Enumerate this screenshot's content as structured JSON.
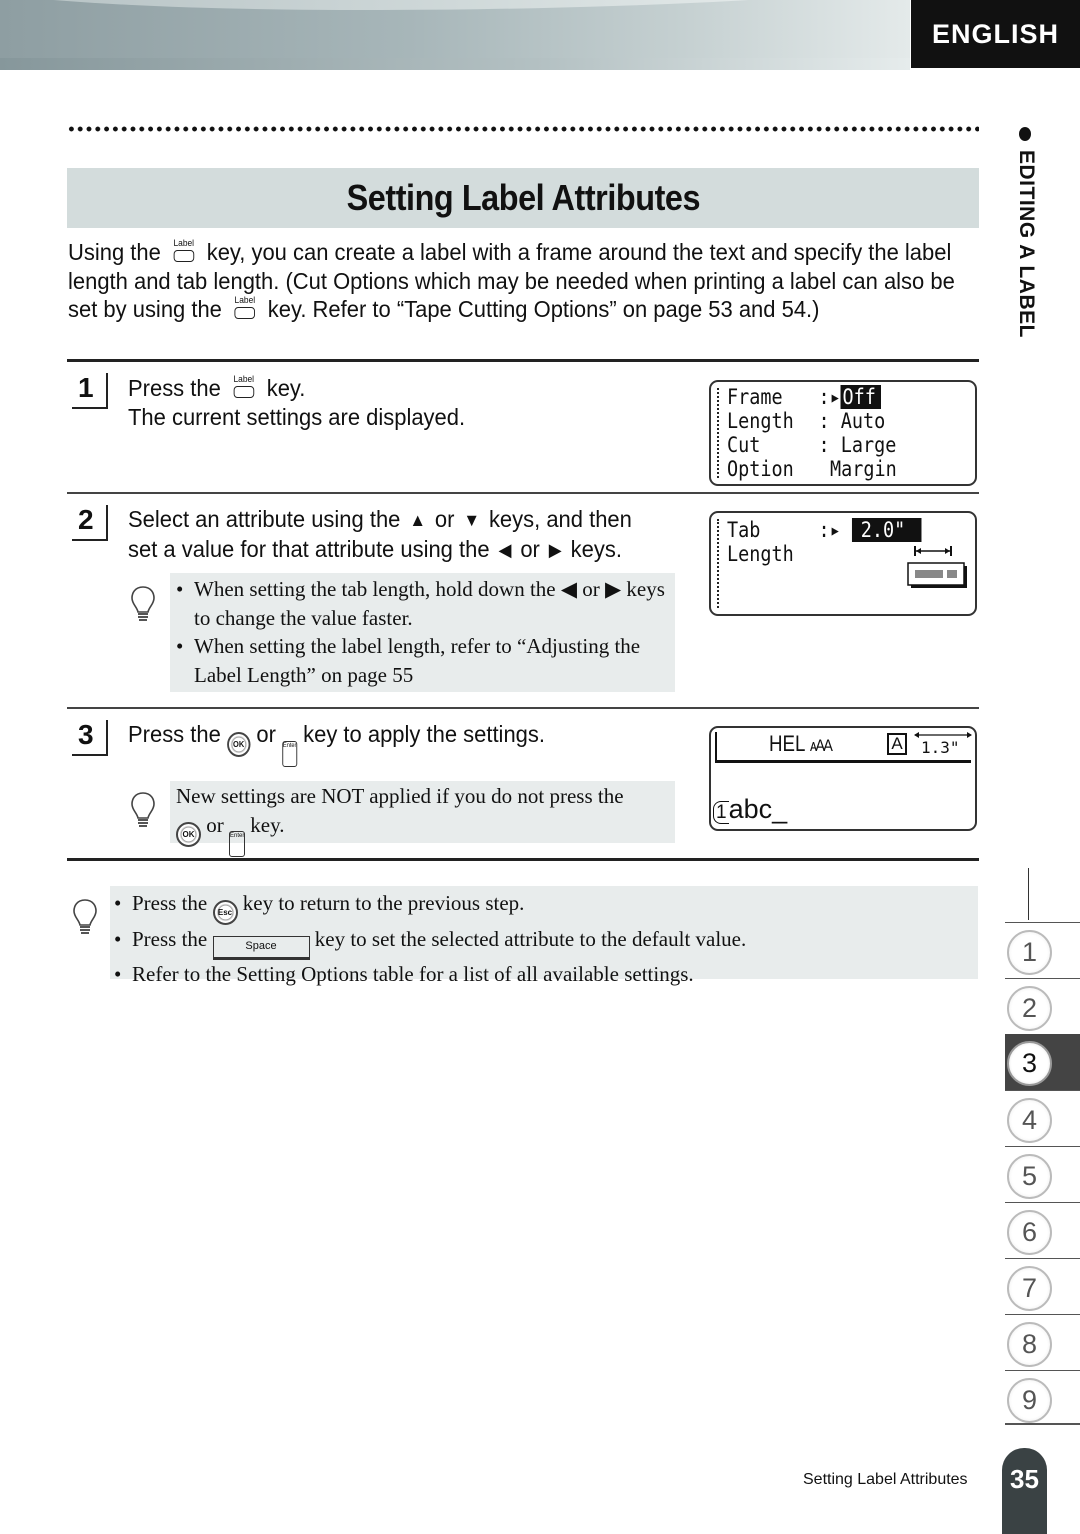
{
  "header": {
    "language_tab": "ENGLISH"
  },
  "side": {
    "section_title": "EDITING A LABEL"
  },
  "page": {
    "title": "Setting Label Attributes",
    "intro": {
      "p1": "Using the",
      "p2": "key, you can create a label with a frame around the text and specify the label length and tab length. (Cut Options which may be needed when printing a label can also be set by using the",
      "p3": "key. Refer to “Tape Cutting Options”  on page 53 and 54.)"
    },
    "key_labels": {
      "label": "Label",
      "ok": "OK",
      "enter": "Enter",
      "esc": "Esc",
      "space": "Space"
    },
    "steps": [
      {
        "number": "1",
        "line1_pre": "Press the",
        "line1_post": "key.",
        "line2": "The current settings are displayed.",
        "lcd": [
          {
            "name": "Frame",
            "sep": ":▸",
            "value": "Off",
            "selected": true
          },
          {
            "name": "Length",
            "sep": ":",
            "value": "Auto"
          },
          {
            "name": "Cut",
            "sep": ":",
            "value": "Large"
          },
          {
            "name": "Option",
            "sep": "",
            "value": "Margin"
          }
        ]
      },
      {
        "number": "2",
        "line1_pre": "Select an attribute using the",
        "up": "▲",
        "or": "or",
        "down": "▼",
        "line1_post": "keys, and then",
        "line2_pre": "set a value for that attribute using the",
        "left": "◀",
        "right": "▶",
        "line2_post": "keys.",
        "hints": [
          "When setting the tab length, hold down the ◀ or ▶ keys to change the value faster.",
          "When setting the label length, refer to “Adjusting the Label Length” on page 55"
        ],
        "lcd": [
          {
            "name": "Tab",
            "sep": ":▸",
            "value": "2.0\"",
            "selected": true
          },
          {
            "name": "Length",
            "sep": "",
            "value": ""
          }
        ]
      },
      {
        "number": "3",
        "pre": "Press the",
        "or": "or",
        "post": "key to apply the settings.",
        "hint_pre": "New settings are NOT applied if you do not press the",
        "hint_or": "or",
        "hint_post": "key.",
        "lcd": {
          "top_text": "HEL",
          "size_glyphs": "ᴀAA",
          "style_glyph": "A",
          "length": "1.3\"",
          "line_text": "abc_",
          "line_number": "1"
        }
      }
    ],
    "bottom_hints": [
      {
        "pre": "Press the",
        "key": "esc",
        "post": "key to return to the previous step."
      },
      {
        "pre": "Press the",
        "key": "space",
        "post": "key to set the selected attribute to the default value."
      },
      {
        "pre": "Refer to the Setting Options table for a list of all available settings.",
        "key": "",
        "post": ""
      }
    ]
  },
  "chapters": [
    "1",
    "2",
    "3",
    "4",
    "5",
    "6",
    "7",
    "8",
    "9"
  ],
  "active_chapter": "3",
  "footer": {
    "running_title": "Setting Label Attributes",
    "page_number": "35"
  }
}
